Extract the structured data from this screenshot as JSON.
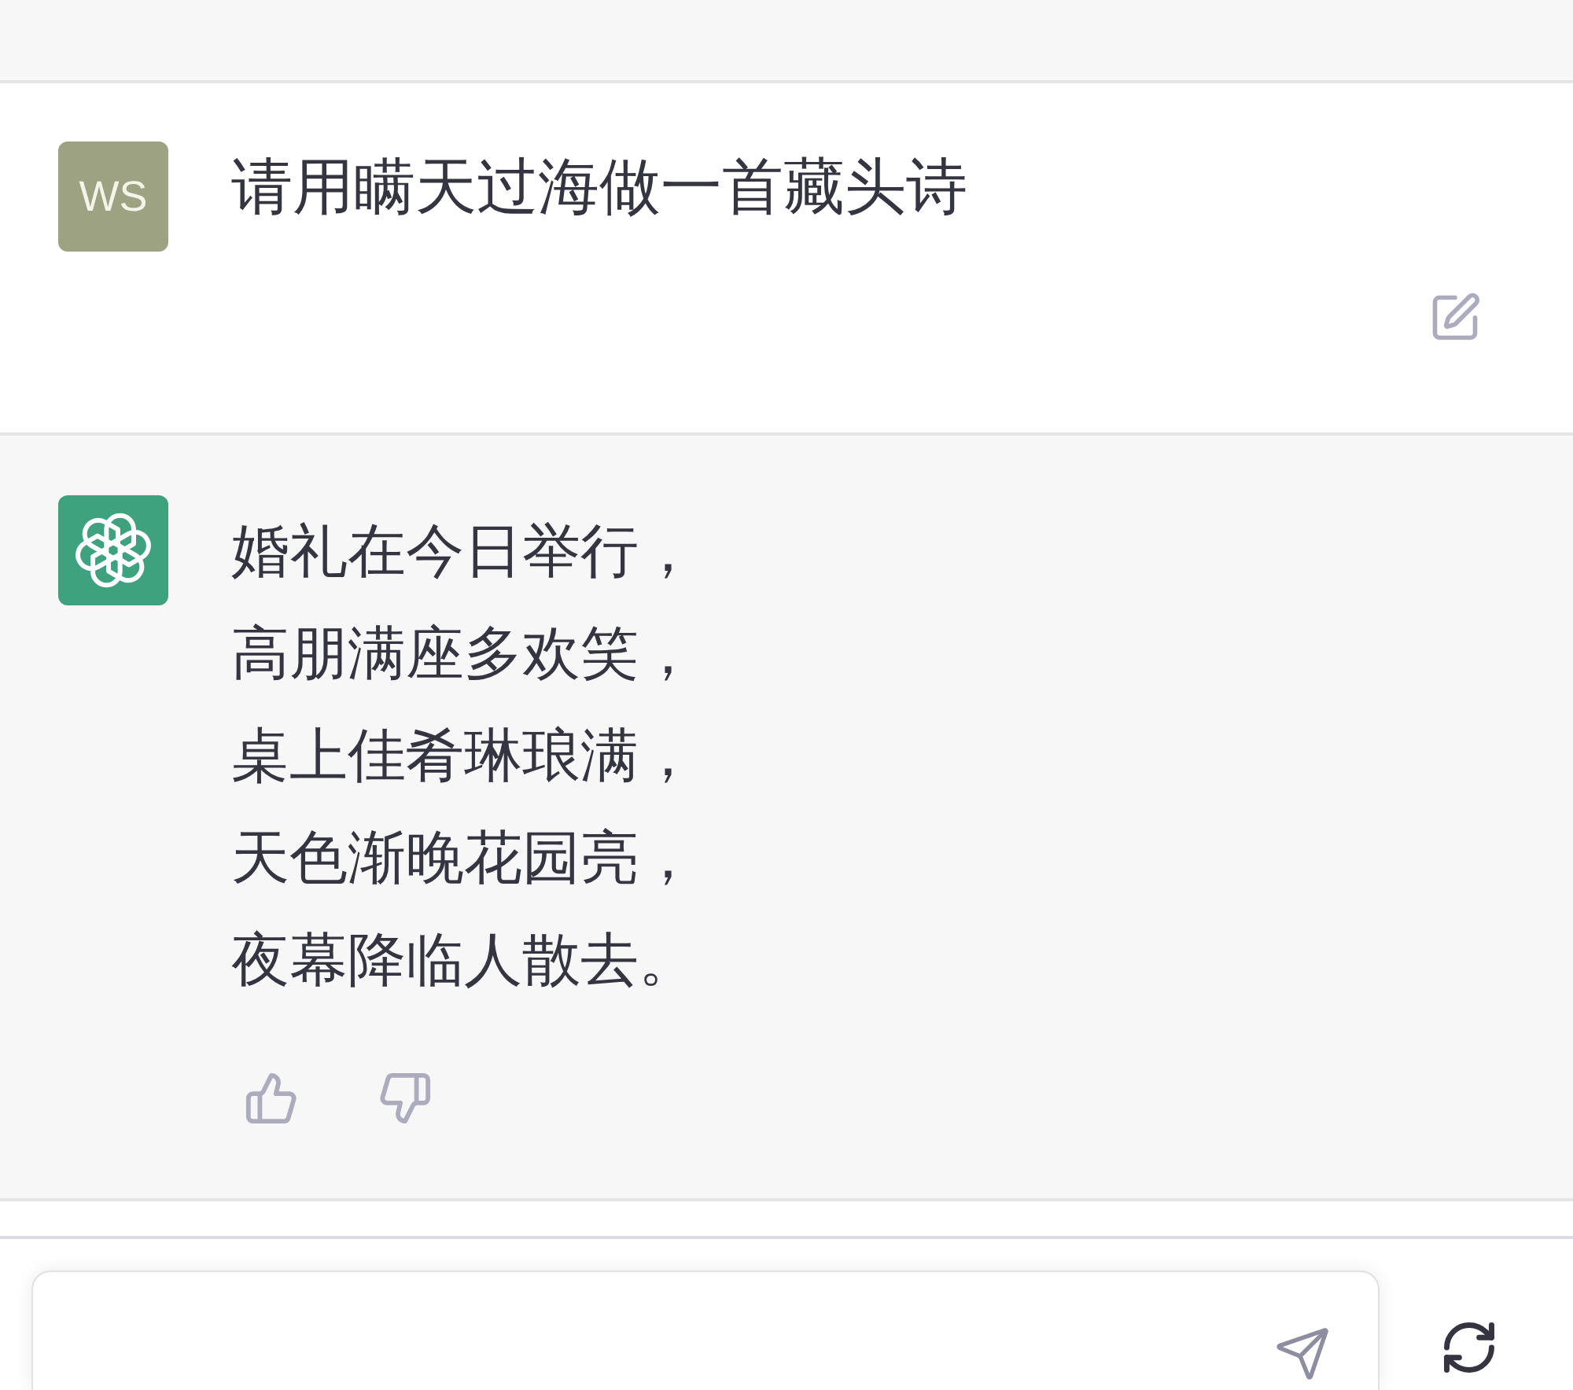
{
  "messages": [
    {
      "kind": "user",
      "avatar": "WS",
      "text": "请用瞒天过海做一首藏头诗"
    },
    {
      "kind": "assistant",
      "lines": [
        "婚礼在今日举行，",
        "高朋满座多欢笑，",
        "桌上佳肴琳琅满，",
        "天色渐晚花园亮，",
        "夜幕降临人散去。"
      ]
    }
  ]
}
